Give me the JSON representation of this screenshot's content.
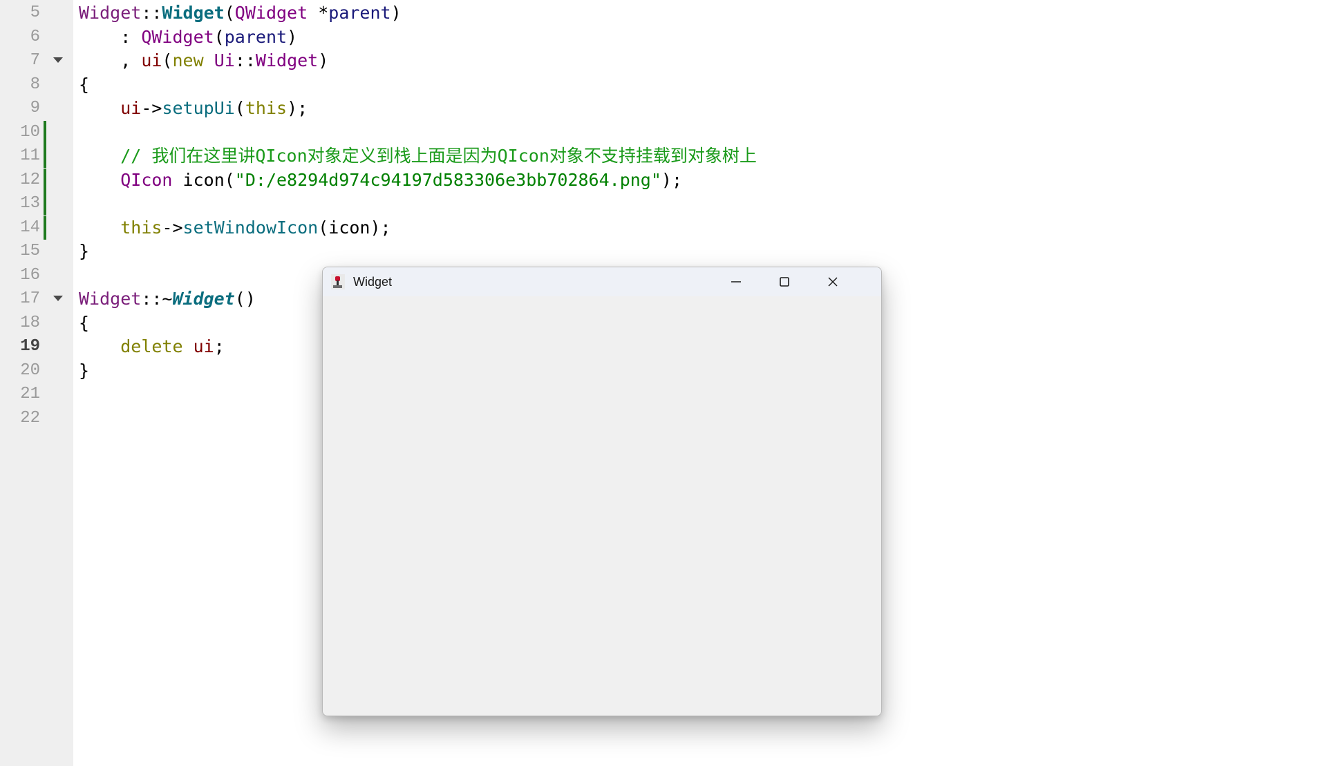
{
  "editor": {
    "current_line": "19",
    "lines": [
      {
        "number": "5",
        "tokens": [
          {
            "text": "Widget",
            "cls": "t-def"
          },
          {
            "text": "::",
            "cls": "t-plain"
          },
          {
            "text": "Widget",
            "cls": "t-fnb"
          },
          {
            "text": "(",
            "cls": "t-plain"
          },
          {
            "text": "QWidget",
            "cls": "t-type"
          },
          {
            "text": " *",
            "cls": "t-plain"
          },
          {
            "text": "parent",
            "cls": "t-param"
          },
          {
            "text": ")",
            "cls": "t-plain"
          }
        ]
      },
      {
        "number": "6",
        "tokens": [
          {
            "text": "    : ",
            "cls": "t-plain"
          },
          {
            "text": "QWidget",
            "cls": "t-type"
          },
          {
            "text": "(",
            "cls": "t-plain"
          },
          {
            "text": "parent",
            "cls": "t-param"
          },
          {
            "text": ")",
            "cls": "t-plain"
          }
        ]
      },
      {
        "number": "7",
        "fold": true,
        "tokens": [
          {
            "text": "    , ",
            "cls": "t-plain"
          },
          {
            "text": "ui",
            "cls": "t-mem"
          },
          {
            "text": "(",
            "cls": "t-plain"
          },
          {
            "text": "new",
            "cls": "t-kw"
          },
          {
            "text": " ",
            "cls": "t-plain"
          },
          {
            "text": "Ui",
            "cls": "t-type"
          },
          {
            "text": "::",
            "cls": "t-plain"
          },
          {
            "text": "Widget",
            "cls": "t-type"
          },
          {
            "text": ")",
            "cls": "t-plain"
          }
        ]
      },
      {
        "number": "8",
        "tokens": [
          {
            "text": "{",
            "cls": "t-plain"
          }
        ]
      },
      {
        "number": "9",
        "tokens": [
          {
            "text": "    ",
            "cls": "t-plain"
          },
          {
            "text": "ui",
            "cls": "t-mem"
          },
          {
            "text": "->",
            "cls": "t-plain"
          },
          {
            "text": "setupUi",
            "cls": "t-call"
          },
          {
            "text": "(",
            "cls": "t-plain"
          },
          {
            "text": "this",
            "cls": "t-kw"
          },
          {
            "text": ");",
            "cls": "t-plain"
          }
        ]
      },
      {
        "number": "10",
        "modified": true,
        "tokens": []
      },
      {
        "number": "11",
        "modified": true,
        "tokens": [
          {
            "text": "    // 我们在这里讲QIcon对象定义到栈上面是因为QIcon对象不支持挂载到对象树上",
            "cls": "t-cmt"
          }
        ]
      },
      {
        "number": "12",
        "modified": true,
        "tokens": [
          {
            "text": "    ",
            "cls": "t-plain"
          },
          {
            "text": "QIcon",
            "cls": "t-type"
          },
          {
            "text": " icon(",
            "cls": "t-plain"
          },
          {
            "text": "\"D:/e8294d974c94197d583306e3bb702864.png\"",
            "cls": "t-str"
          },
          {
            "text": ");",
            "cls": "t-plain"
          }
        ]
      },
      {
        "number": "13",
        "modified": true,
        "tokens": []
      },
      {
        "number": "14",
        "modified": true,
        "tokens": [
          {
            "text": "    ",
            "cls": "t-plain"
          },
          {
            "text": "this",
            "cls": "t-kw"
          },
          {
            "text": "->",
            "cls": "t-plain"
          },
          {
            "text": "setWindowIcon",
            "cls": "t-call"
          },
          {
            "text": "(icon);",
            "cls": "t-plain"
          }
        ]
      },
      {
        "number": "15",
        "tokens": [
          {
            "text": "}",
            "cls": "t-plain"
          }
        ]
      },
      {
        "number": "16",
        "tokens": []
      },
      {
        "number": "17",
        "fold": true,
        "tokens": [
          {
            "text": "Widget",
            "cls": "t-def"
          },
          {
            "text": "::~",
            "cls": "t-plain"
          },
          {
            "text": "Widget",
            "cls": "t-fnbi"
          },
          {
            "text": "()",
            "cls": "t-plain"
          }
        ]
      },
      {
        "number": "18",
        "tokens": [
          {
            "text": "{",
            "cls": "t-plain"
          }
        ]
      },
      {
        "number": "19",
        "tokens": [
          {
            "text": "    ",
            "cls": "t-plain"
          },
          {
            "text": "delete",
            "cls": "t-kw"
          },
          {
            "text": " ",
            "cls": "t-plain"
          },
          {
            "text": "ui",
            "cls": "t-mem"
          },
          {
            "text": ";",
            "cls": "t-plain"
          }
        ]
      },
      {
        "number": "20",
        "tokens": [
          {
            "text": "}",
            "cls": "t-plain"
          }
        ]
      },
      {
        "number": "21",
        "tokens": []
      },
      {
        "number": "22",
        "tokens": []
      }
    ]
  },
  "window": {
    "title": "Widget",
    "icon": "app-icon",
    "controls": {
      "minimize": "minimize-icon",
      "maximize": "maximize-icon",
      "close": "close-icon"
    }
  }
}
